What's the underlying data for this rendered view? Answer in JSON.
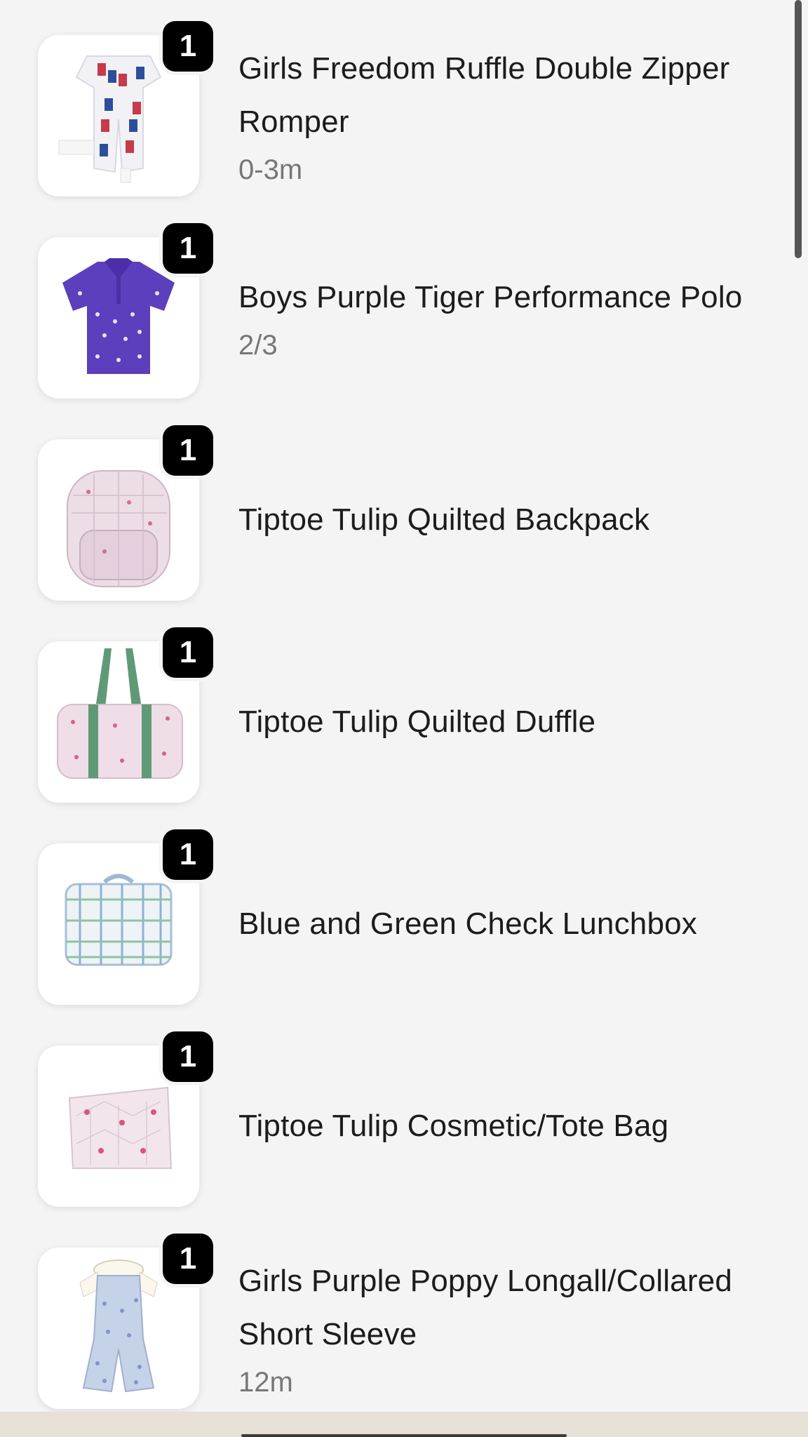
{
  "cart": {
    "items": [
      {
        "name": "Girls Freedom Ruffle Double Zipper Romper",
        "variant": "0-3m",
        "quantity": "1",
        "image": "romper-image"
      },
      {
        "name": "Boys Purple Tiger Performance Polo",
        "variant": "2/3",
        "quantity": "1",
        "image": "polo-shirt-image"
      },
      {
        "name": "Tiptoe Tulip Quilted Backpack",
        "variant": "",
        "quantity": "1",
        "image": "backpack-image"
      },
      {
        "name": "Tiptoe Tulip Quilted Duffle",
        "variant": "",
        "quantity": "1",
        "image": "duffle-bag-image"
      },
      {
        "name": "Blue and Green Check Lunchbox",
        "variant": "",
        "quantity": "1",
        "image": "lunchbox-image"
      },
      {
        "name": "Tiptoe Tulip Cosmetic/Tote Bag",
        "variant": "",
        "quantity": "1",
        "image": "cosmetic-bag-image"
      },
      {
        "name": "Girls Purple Poppy Longall/Collared Short Sleeve",
        "variant": "12m",
        "quantity": "1",
        "image": "longall-image"
      }
    ]
  },
  "colors": {
    "background": "#f4f4f4",
    "badge": "#000000",
    "variant_text": "#777777"
  }
}
